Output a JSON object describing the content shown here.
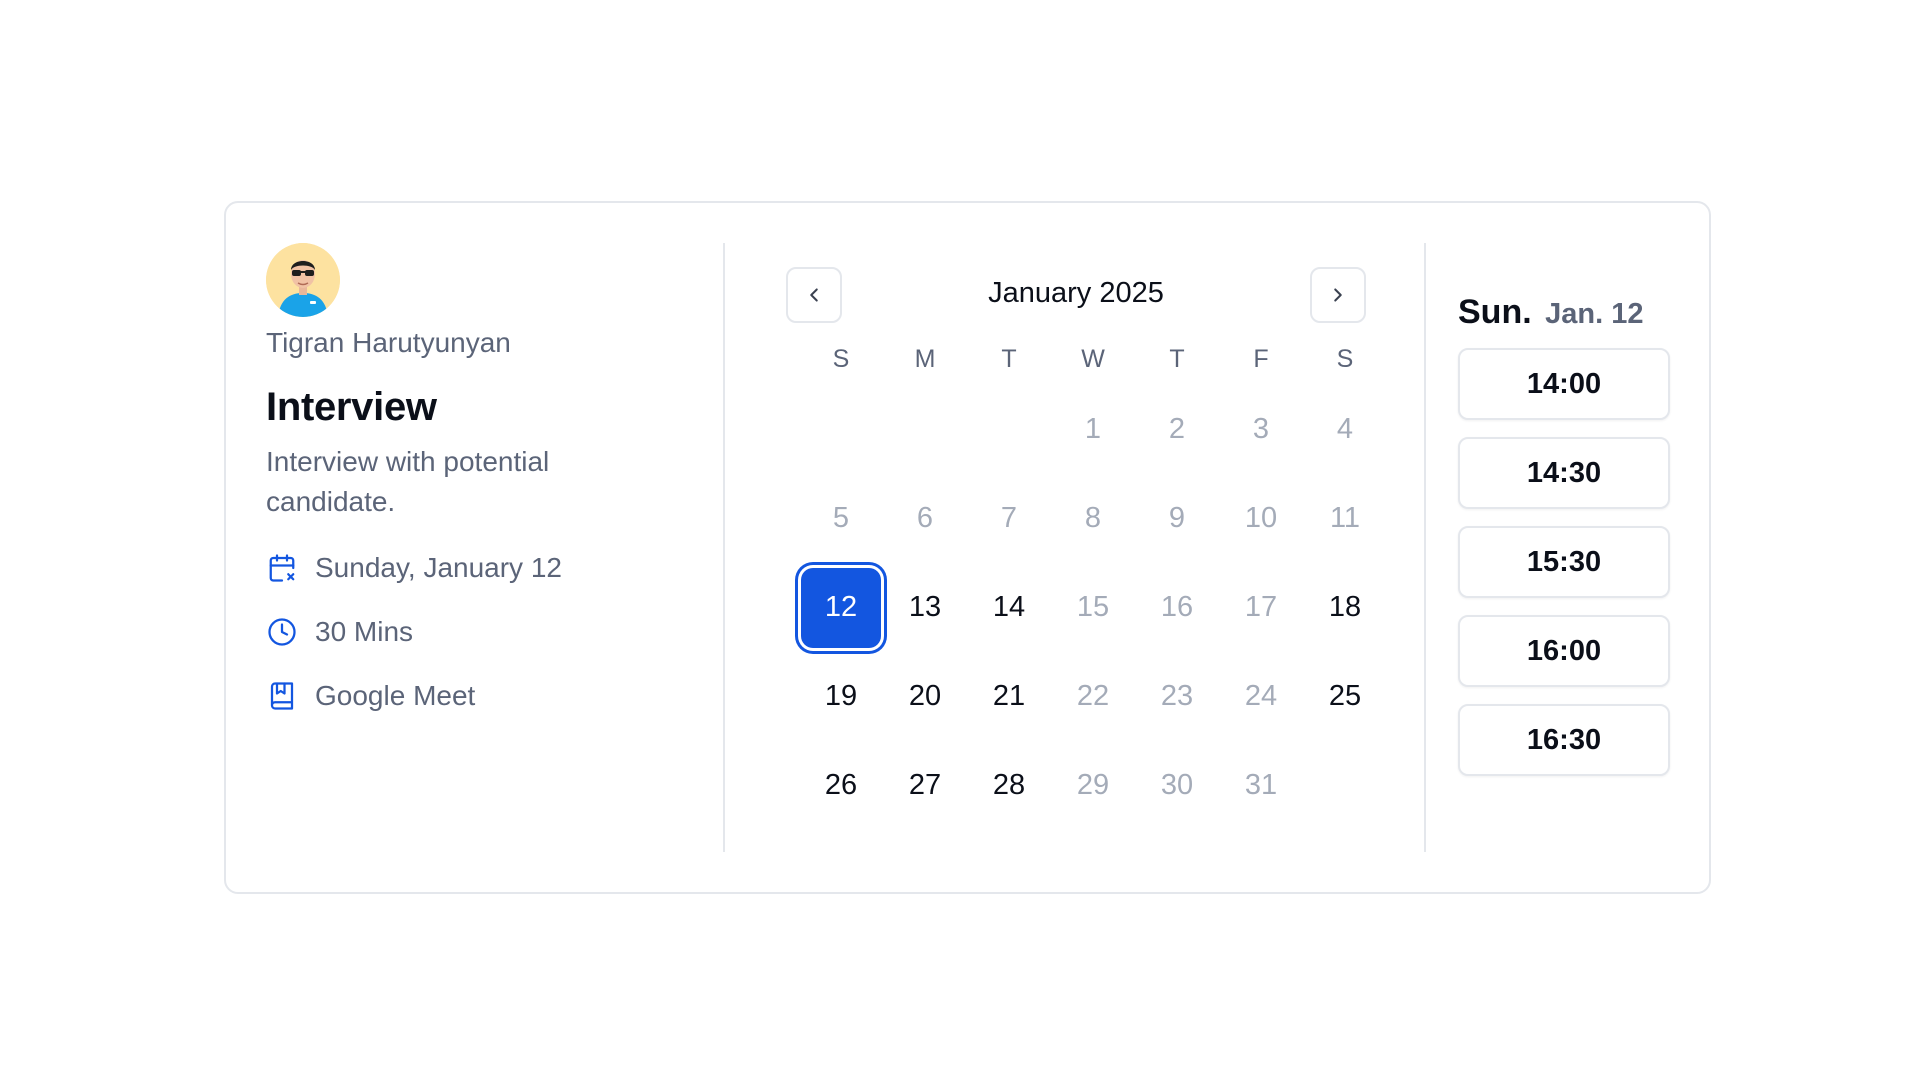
{
  "host": {
    "name": "Tigran Harutyunyan"
  },
  "event": {
    "title": "Interview",
    "description": "Interview with potential candidate.",
    "details": [
      {
        "icon": "calendar-x-icon",
        "text": "Sunday, January 12"
      },
      {
        "icon": "clock-icon",
        "text": "30 Mins"
      },
      {
        "icon": "book-bookmark-icon",
        "text": "Google Meet"
      }
    ]
  },
  "calendar": {
    "month_label": "January 2025",
    "weekdays": [
      "S",
      "M",
      "T",
      "W",
      "T",
      "F",
      "S"
    ],
    "leading_blanks": 3,
    "days": [
      {
        "n": "1",
        "state": "disabled"
      },
      {
        "n": "2",
        "state": "disabled"
      },
      {
        "n": "3",
        "state": "disabled"
      },
      {
        "n": "4",
        "state": "disabled"
      },
      {
        "n": "5",
        "state": "disabled"
      },
      {
        "n": "6",
        "state": "disabled"
      },
      {
        "n": "7",
        "state": "disabled"
      },
      {
        "n": "8",
        "state": "disabled"
      },
      {
        "n": "9",
        "state": "disabled"
      },
      {
        "n": "10",
        "state": "disabled"
      },
      {
        "n": "11",
        "state": "disabled"
      },
      {
        "n": "12",
        "state": "selected"
      },
      {
        "n": "13",
        "state": "available"
      },
      {
        "n": "14",
        "state": "available"
      },
      {
        "n": "15",
        "state": "disabled"
      },
      {
        "n": "16",
        "state": "disabled"
      },
      {
        "n": "17",
        "state": "disabled"
      },
      {
        "n": "18",
        "state": "available"
      },
      {
        "n": "19",
        "state": "available"
      },
      {
        "n": "20",
        "state": "available"
      },
      {
        "n": "21",
        "state": "available"
      },
      {
        "n": "22",
        "state": "disabled"
      },
      {
        "n": "23",
        "state": "disabled"
      },
      {
        "n": "24",
        "state": "disabled"
      },
      {
        "n": "25",
        "state": "available"
      },
      {
        "n": "26",
        "state": "available"
      },
      {
        "n": "27",
        "state": "available"
      },
      {
        "n": "28",
        "state": "available"
      },
      {
        "n": "29",
        "state": "disabled"
      },
      {
        "n": "30",
        "state": "disabled"
      },
      {
        "n": "31",
        "state": "disabled"
      }
    ]
  },
  "slots": {
    "day_label": "Sun.",
    "date_label": "Jan. 12",
    "times": [
      "14:00",
      "14:30",
      "15:30",
      "16:00",
      "16:30"
    ]
  },
  "colors": {
    "accent": "#1356e0",
    "muted_text": "#5b6478",
    "disabled_text": "#a4abb8",
    "border": "#e4e7ec"
  }
}
